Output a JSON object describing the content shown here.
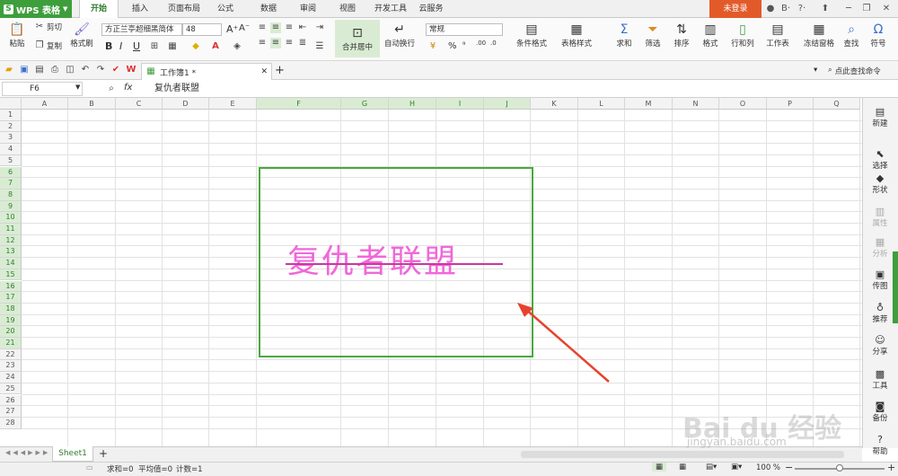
{
  "app": {
    "logo_letter": "S",
    "title": "WPS 表格"
  },
  "tabs": [
    "开始",
    "插入",
    "页面布局",
    "公式",
    "数据",
    "审阅",
    "视图",
    "开发工具",
    "云服务"
  ],
  "login_label": "未登录",
  "title_icons": [
    "bell-icon",
    "skin-icon",
    "help-icon",
    "share-icon",
    "minimize-icon",
    "restore-icon",
    "close-icon"
  ],
  "title_glyphs": [
    "●",
    "B·",
    "?·",
    "⬆",
    "─",
    "❐",
    "✕"
  ],
  "ribbon": {
    "paste": "粘贴",
    "cut": "剪切",
    "copy": "复制",
    "format_painter": "格式刷",
    "font_name": "方正兰亭超细黑简体",
    "font_size": "48",
    "bold": "B",
    "italic": "I",
    "underline": "U",
    "merge_center": "合并居中",
    "wrap_text": "自动换行",
    "number_format": "常规",
    "percent": "%",
    "comma": "⁹",
    "cond_format": "条件格式",
    "table_style": "表格样式",
    "sum": "求和",
    "filter": "筛选",
    "sort": "排序",
    "format": "格式",
    "rowcol": "行和列",
    "worksheet": "工作表",
    "freeze": "冻结窗格",
    "find": "查找",
    "symbol": "符号"
  },
  "doc": {
    "tab_title": "工作簿1 *",
    "find_command": "点此查找命令"
  },
  "formula_bar": {
    "cell_ref": "F6",
    "fx": "fx",
    "value": "复仇者联盟"
  },
  "columns": [
    "A",
    "B",
    "C",
    "D",
    "E",
    "F",
    "G",
    "H",
    "I",
    "J",
    "K",
    "L",
    "M",
    "N",
    "O",
    "P",
    "Q"
  ],
  "rows": [
    "1",
    "2",
    "3",
    "4",
    "5",
    "6",
    "7",
    "8",
    "9",
    "10",
    "11",
    "12",
    "13",
    "14",
    "15",
    "16",
    "17",
    "18",
    "19",
    "20",
    "21",
    "22",
    "23",
    "24",
    "25",
    "26",
    "27",
    "28"
  ],
  "selected_cols": [
    "F",
    "G",
    "H",
    "I",
    "J"
  ],
  "selected_rows": [
    "6",
    "7",
    "8",
    "9",
    "10",
    "11",
    "12",
    "13",
    "14",
    "15",
    "16",
    "17",
    "18",
    "19",
    "20",
    "21"
  ],
  "merged_cell_text": "复仇者联盟",
  "right_panel": [
    {
      "label": "新建",
      "icon": "new-doc-icon",
      "glyph": "▤",
      "enabled": true
    },
    {
      "label": "选择",
      "icon": "select-icon",
      "glyph": "⬉",
      "enabled": true
    },
    {
      "label": "形状",
      "icon": "shape-icon",
      "glyph": "◆",
      "enabled": true
    },
    {
      "label": "属性",
      "icon": "properties-icon",
      "glyph": "▥",
      "enabled": false
    },
    {
      "label": "分析",
      "icon": "analysis-icon",
      "glyph": "▦",
      "enabled": false
    },
    {
      "label": "传图",
      "icon": "upload-image-icon",
      "glyph": "▣",
      "enabled": true
    },
    {
      "label": "推荐",
      "icon": "recommend-icon",
      "glyph": "♁",
      "enabled": true
    },
    {
      "label": "分享",
      "icon": "share-user-icon",
      "glyph": "☺",
      "enabled": true
    },
    {
      "label": "工具",
      "icon": "toolbox-icon",
      "glyph": "▩",
      "enabled": true
    },
    {
      "label": "备份",
      "icon": "backup-icon",
      "glyph": "◙",
      "enabled": true
    },
    {
      "label": "帮助",
      "icon": "help-circle-icon",
      "glyph": "?",
      "enabled": true
    }
  ],
  "sheet": {
    "name": "Sheet1",
    "add": "+"
  },
  "status": {
    "sum": "求和=0",
    "avg": "平均值=0",
    "count": "计数=1",
    "zoom": "100 %",
    "minus": "−",
    "plus": "+"
  },
  "watermark": {
    "brand": "Bai du 经验",
    "url": "jingyan.baidu.com"
  },
  "colors": {
    "accent": "#3e9e3c",
    "login": "#e35a2a",
    "text_pink": "#f068d9",
    "arrow": "#e8422e"
  }
}
